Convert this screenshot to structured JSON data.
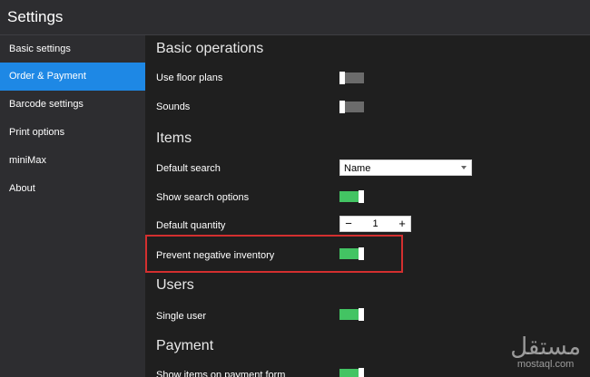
{
  "window": {
    "title": "Settings"
  },
  "sidebar": {
    "items": [
      {
        "label": "Basic settings",
        "active": false
      },
      {
        "label": "Order & Payment",
        "active": true
      },
      {
        "label": "Barcode settings",
        "active": false
      },
      {
        "label": "Print options",
        "active": false
      },
      {
        "label": "miniMax",
        "active": false
      },
      {
        "label": "About",
        "active": false
      }
    ]
  },
  "sections": {
    "basic": {
      "title": "Basic operations",
      "use_floor_plans": {
        "label": "Use floor plans",
        "on": false
      },
      "sounds": {
        "label": "Sounds",
        "on": false
      }
    },
    "items": {
      "title": "Items",
      "default_search": {
        "label": "Default search",
        "value": "Name"
      },
      "show_search_options": {
        "label": "Show search options",
        "on": true
      },
      "default_quantity": {
        "label": "Default quantity",
        "value": "1",
        "minus": "−",
        "plus": "+"
      },
      "prevent_negative_inventory": {
        "label": "Prevent negative inventory",
        "on": true
      }
    },
    "users": {
      "title": "Users",
      "single_user": {
        "label": "Single user",
        "on": true
      }
    },
    "payment": {
      "title": "Payment",
      "show_items_on_payment_form": {
        "label": "Show items on payment form",
        "on": true
      }
    }
  },
  "colors": {
    "accent": "#1e88e5",
    "toggle_on": "#43c463",
    "toggle_off": "#6b6b6b",
    "highlight": "#d32f2f"
  },
  "watermark": {
    "arabic": "مستقل",
    "latin": "mostaql.com"
  }
}
